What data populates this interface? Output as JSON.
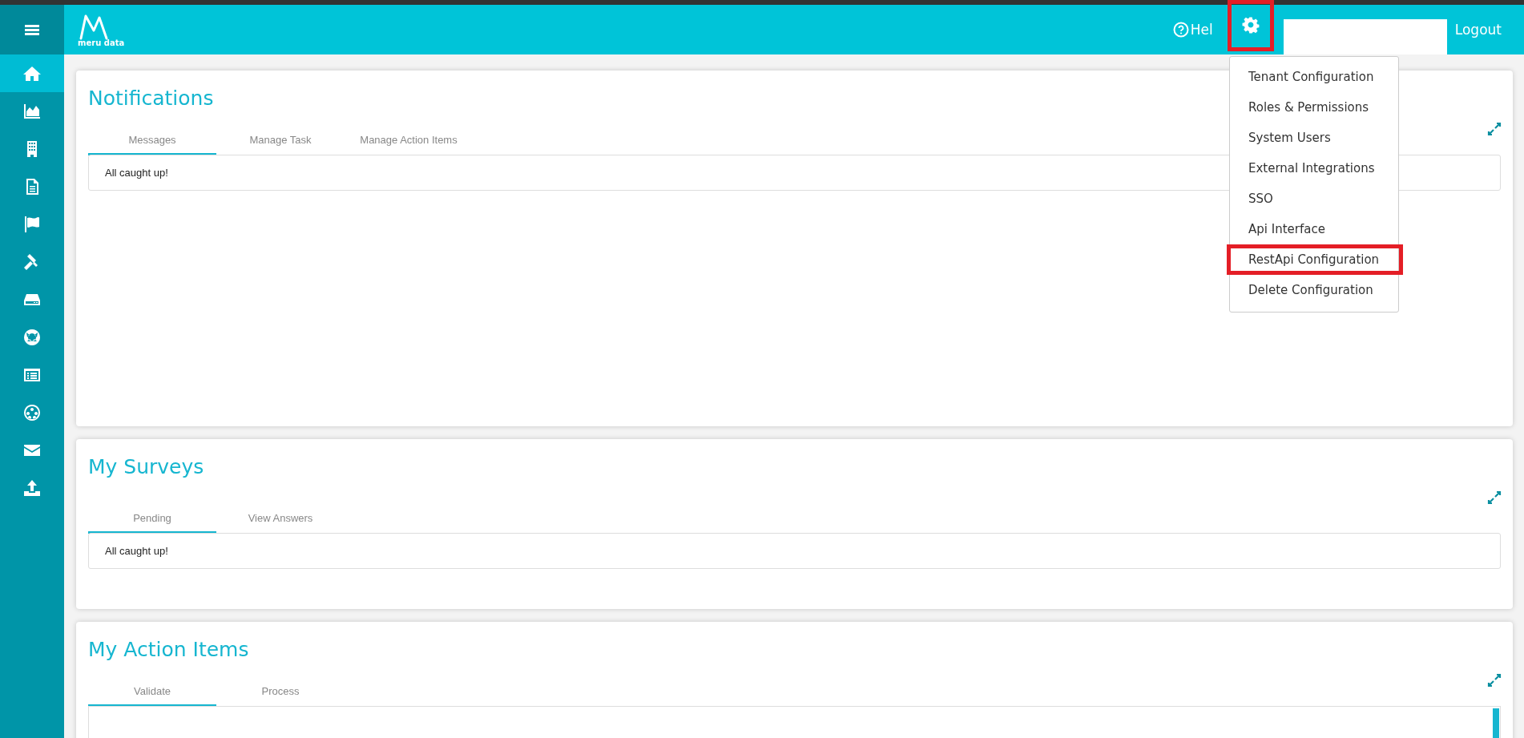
{
  "sidebar": {
    "items": [
      {
        "selected": true
      },
      {
        "selected": false
      },
      {
        "selected": false
      },
      {
        "selected": false
      },
      {
        "selected": false
      },
      {
        "selected": false
      },
      {
        "selected": false
      },
      {
        "selected": false
      },
      {
        "selected": false
      },
      {
        "selected": false
      },
      {
        "selected": false
      },
      {
        "selected": false
      }
    ]
  },
  "header": {
    "logo_text": "meru data",
    "help": "Hel",
    "settings": {
      "highlighted": true
    },
    "logout": "Logout"
  },
  "settings_menu": {
    "items": [
      {
        "label": "Tenant Configuration",
        "highlighted": false
      },
      {
        "label": "Roles & Permissions",
        "highlighted": false
      },
      {
        "label": "System Users",
        "highlighted": false
      },
      {
        "label": "External Integrations",
        "highlighted": false
      },
      {
        "label": "SSO",
        "highlighted": false
      },
      {
        "label": "Api Interface",
        "highlighted": false
      },
      {
        "label": "RestApi Configuration",
        "highlighted": true
      },
      {
        "label": "Delete Configuration",
        "highlighted": false
      }
    ]
  },
  "cards": [
    {
      "title": "Notifications",
      "tabs": [
        {
          "label": "Messages",
          "selected": true
        },
        {
          "label": "Manage Task",
          "selected": false
        },
        {
          "label": "Manage Action Items",
          "selected": false
        }
      ],
      "message": "All caught up!"
    },
    {
      "title": "My Surveys",
      "tabs": [
        {
          "label": "Pending",
          "selected": true
        },
        {
          "label": "View Answers",
          "selected": false
        }
      ],
      "message": "All caught up!"
    },
    {
      "title": "My Action Items",
      "tabs": [
        {
          "label": "Validate",
          "selected": true
        },
        {
          "label": "Process",
          "selected": false
        }
      ]
    }
  ]
}
